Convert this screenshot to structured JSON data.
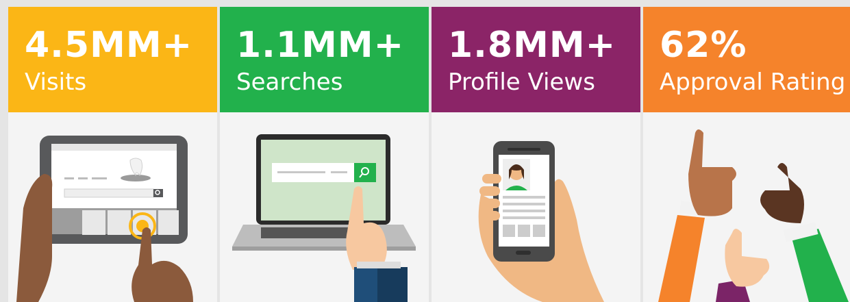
{
  "stats": [
    {
      "value": "4.5MM+",
      "label": "Visits",
      "color": "#fbb616",
      "icon": "tablet-hand-icon"
    },
    {
      "value": "1.1MM+",
      "label": "Searches",
      "color": "#22b14c",
      "icon": "laptop-search-icon"
    },
    {
      "value": "1.8MM+",
      "label": "Profile Views",
      "color": "#8b2467",
      "icon": "phone-profile-icon"
    },
    {
      "value": "62%",
      "label": "Approval Rating",
      "color": "#f5832b",
      "icon": "thumbs-up-icon"
    }
  ]
}
